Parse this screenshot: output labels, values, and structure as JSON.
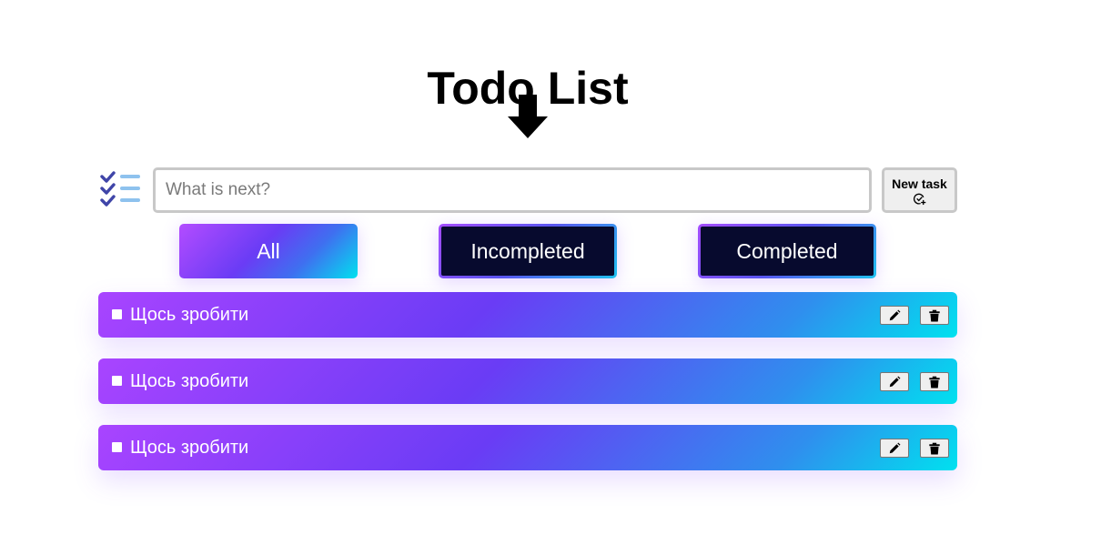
{
  "header": {
    "title": "Todo List"
  },
  "input": {
    "placeholder": "What is next?",
    "value": ""
  },
  "new_task_button": {
    "label": "New task",
    "icon": "check-circle-plus-icon"
  },
  "filters": [
    {
      "label": "All",
      "active": true
    },
    {
      "label": "Incompleted",
      "active": false
    },
    {
      "label": "Completed",
      "active": false
    }
  ],
  "todos": [
    {
      "text": "Щось зробити",
      "completed": false
    },
    {
      "text": "Щось зробити",
      "completed": false
    },
    {
      "text": "Щось зробити",
      "completed": false
    }
  ],
  "icons": {
    "decoration": "arrow-down-icon",
    "list": "checklist-icon",
    "edit": "pencil-icon",
    "delete": "trash-icon"
  },
  "colors": {
    "gradient_start": "#a944ff",
    "gradient_mid": "#6a3cf5",
    "gradient_end": "#00e1ef",
    "dark_button": "#070a2e"
  }
}
